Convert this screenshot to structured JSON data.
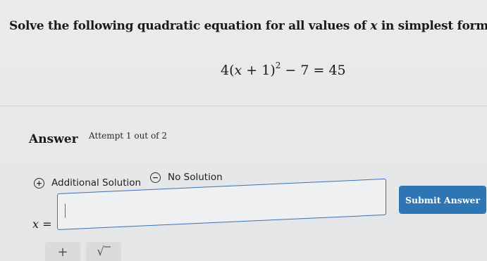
{
  "question": {
    "prompt_before": "Solve the following quadratic equation for all values of ",
    "prompt_var": "x",
    "prompt_after": " in simplest form."
  },
  "equation": {
    "coefficient": "4(",
    "variable": "x",
    "inner": " + 1)",
    "exponent": "2",
    "rest": " − 7 = 45"
  },
  "answer": {
    "label": "Answer",
    "attempt": "Attempt 1 out of 2",
    "options": {
      "additional_solution": "Additional Solution",
      "additional_icon": "plus-circle-icon",
      "no_solution": "No Solution",
      "no_solution_icon": "minus-circle-icon"
    },
    "input": {
      "variable": "x",
      "equals": " =",
      "value": ""
    },
    "submit_label": "Submit Answer"
  },
  "keypad": {
    "plus_symbol": "+",
    "sqrt_symbol": "√‾"
  },
  "colors": {
    "accent": "#2e75b3",
    "input_border": "#3d6fb6",
    "background": "#e7e9ea"
  }
}
